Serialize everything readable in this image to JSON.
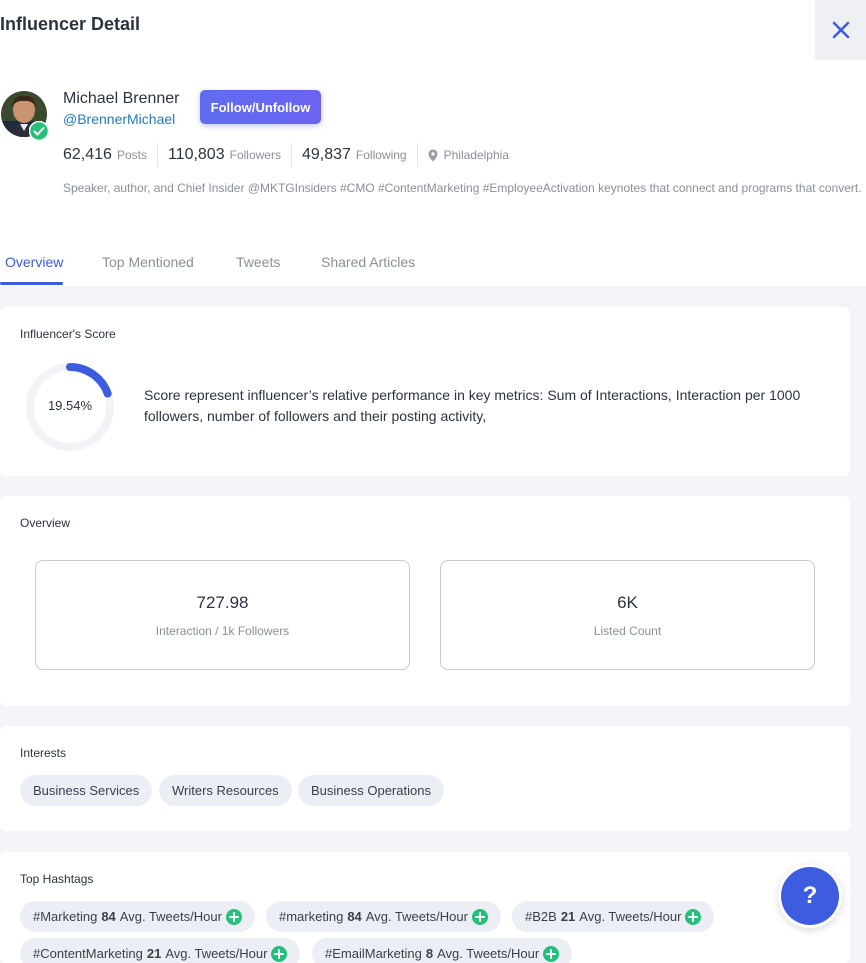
{
  "header": {
    "title": "Influencer Detail",
    "close_icon": "close-icon"
  },
  "profile": {
    "name": "Michael Brenner",
    "handle": "@BrennerMichael",
    "follow_label": "Follow/Unfollow",
    "avatar_icon": "avatar",
    "verified_icon": "verified-badge-icon",
    "stats": [
      {
        "value": "62,416",
        "label": "Posts"
      },
      {
        "value": "110,803",
        "label": "Followers"
      },
      {
        "value": "49,837",
        "label": "Following"
      }
    ],
    "location": "Philadelphia",
    "bio": "Speaker, author, and Chief Insider @MKTGInsiders #CMO #ContentMarketing #EmployeeActivation keynotes that connect and programs that convert."
  },
  "tabs": [
    {
      "label": "Overview",
      "active": true
    },
    {
      "label": "Top Mentioned",
      "active": false
    },
    {
      "label": "Tweets",
      "active": false
    },
    {
      "label": "Shared Articles",
      "active": false
    }
  ],
  "score": {
    "title": "Influencer's Score",
    "value_text": "19.54%",
    "percent": 19.54,
    "description": "Score represent influencer’s relative performance in key metrics: Sum of Interactions, Interaction per 1000 followers, number of followers and their posting activity,"
  },
  "overview": {
    "title": "Overview",
    "metrics": [
      {
        "value": "727.98",
        "label": "Interaction / 1k Followers"
      },
      {
        "value": "6K",
        "label": "Listed Count"
      }
    ]
  },
  "interests": {
    "title": "Interests",
    "items": [
      "Business Services",
      "Writers Resources",
      "Business Operations"
    ]
  },
  "hashtags": {
    "title": "Top Hashtags",
    "suffix": "Avg. Tweets/Hour",
    "items": [
      {
        "tag": "#Marketing",
        "count": "84"
      },
      {
        "tag": "#marketing",
        "count": "84"
      },
      {
        "tag": "#B2B",
        "count": "21"
      },
      {
        "tag": "#ContentMarketing",
        "count": "21"
      },
      {
        "tag": "#EmailMarketing",
        "count": "8"
      }
    ]
  },
  "help": {
    "label": "?"
  },
  "colors": {
    "accent": "#3d5bd9",
    "follow_button": "#5f6df0",
    "verified": "#27c07a",
    "handle": "#2a7ab8"
  }
}
